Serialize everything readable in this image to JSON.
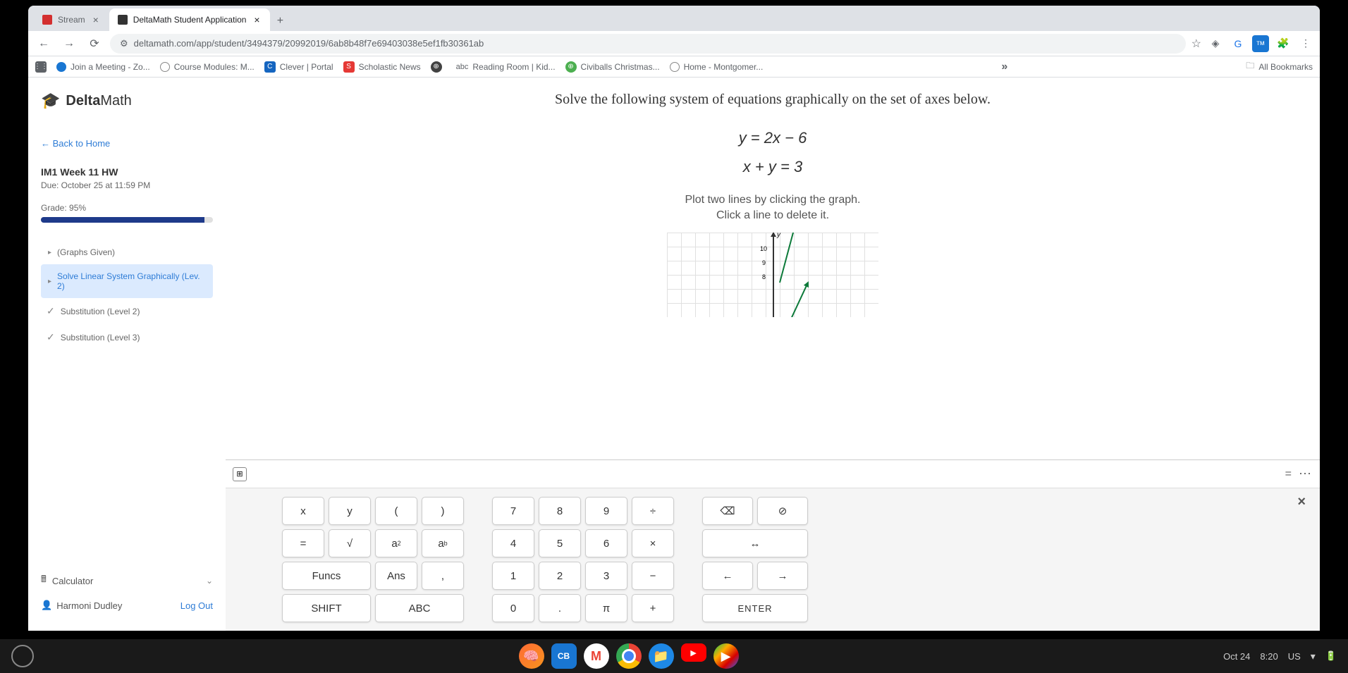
{
  "browser": {
    "tabs": [
      {
        "title": "Stream",
        "active": false
      },
      {
        "title": "DeltaMath Student Application",
        "active": true
      }
    ],
    "url": "deltamath.com/app/student/3494379/20992019/6ab8b48f7e69403038e5ef1fb30361ab",
    "all_bookmarks": "All Bookmarks",
    "bookmarks": [
      "Join a Meeting - Zo...",
      "Course Modules: M...",
      "Clever | Portal",
      "Scholastic News",
      "",
      "Reading Room | Kid...",
      "Civiballs Christmas...",
      "Home - Montgomer..."
    ]
  },
  "sidebar": {
    "logo_delta": "Delta",
    "logo_math": "Math",
    "back": "← Back to Home",
    "assignment": "IM1 Week 11 HW",
    "due": "Due: October 25 at 11:59 PM",
    "grade": "Grade: 95%",
    "topics": [
      {
        "label": "(Graphs Given)",
        "check": "",
        "active": false
      },
      {
        "label": "Solve Linear System Graphically (Lev. 2)",
        "check": "",
        "active": true
      },
      {
        "label": "Substitution (Level 2)",
        "check": "✓",
        "active": false
      },
      {
        "label": "Substitution (Level 3)",
        "check": "✓",
        "active": false
      }
    ],
    "calculator": "Calculator",
    "user": "Harmoni Dudley",
    "logout": "Log Out"
  },
  "problem": {
    "prompt": "Solve the following system of equations graphically on the set of axes below.",
    "eq1": "y = 2x − 6",
    "eq2": "x + y = 3",
    "instr1": "Plot two lines by clicking the graph.",
    "instr2": "Click a line to delete it.",
    "y_label": "y",
    "tick10": "10",
    "tick9": "9",
    "tick8": "8"
  },
  "keyboard": {
    "vars": [
      [
        "x",
        "y",
        "(",
        ")"
      ],
      [
        "=",
        "√",
        "a²",
        "aᵇ"
      ],
      [
        "Funcs",
        "Ans",
        ","
      ],
      [
        "SHIFT",
        "ABC"
      ]
    ],
    "nums": [
      [
        "7",
        "8",
        "9",
        "÷"
      ],
      [
        "4",
        "5",
        "6",
        "×"
      ],
      [
        "1",
        "2",
        "3",
        "−"
      ],
      [
        "0",
        ".",
        "π",
        "+"
      ]
    ],
    "ctrl": {
      "backspace": "⌫",
      "clear": "⊘",
      "swap": "↔",
      "left": "←",
      "right": "→",
      "enter": "ENTER"
    }
  },
  "taskbar": {
    "date": "Oct 24",
    "time": "8:20",
    "locale": "US"
  }
}
